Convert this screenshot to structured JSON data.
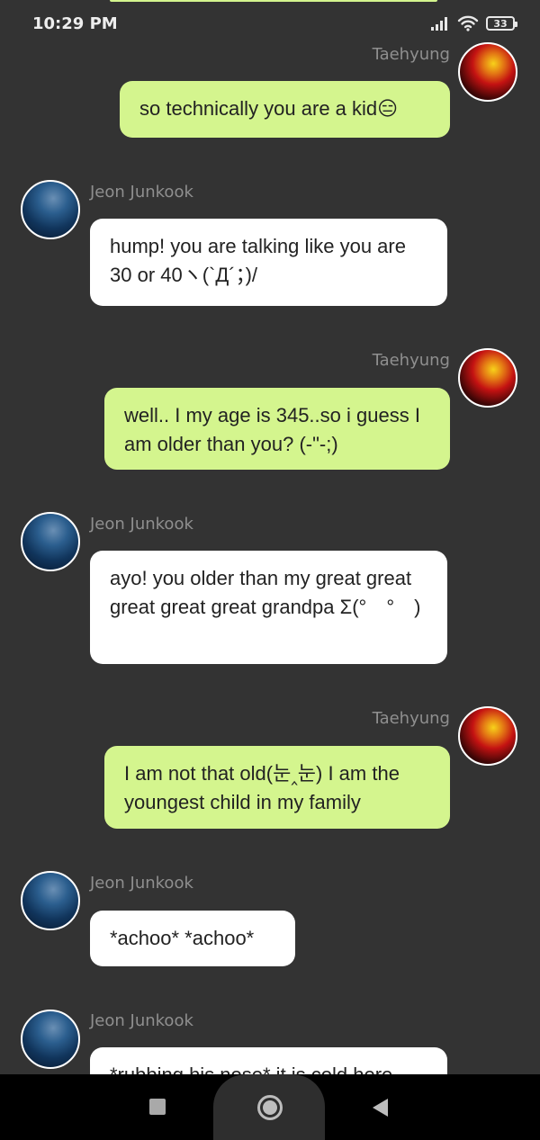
{
  "status_bar": {
    "time": "10:29 PM",
    "battery_level": "33",
    "icons": [
      "signal-icon",
      "wifi-icon",
      "battery-icon"
    ]
  },
  "colors": {
    "background": "#333333",
    "sent_bubble": "#d4f58e",
    "received_bubble": "#ffffff",
    "sender_name": "#8f8f8f"
  },
  "messages": [
    {
      "sender": "Taehyung",
      "side": "right",
      "text": "so technically you are a kid😑"
    },
    {
      "sender": "Jeon Junkook",
      "side": "left",
      "text": "hump! you are talking like you are 30 or 40ヽ(`Д´；)/"
    },
    {
      "sender": "Taehyung",
      "side": "right",
      "text": "well.. I my age is 345..so i guess I am older than you? (-\"-;)"
    },
    {
      "sender": "Jeon Junkook",
      "side": "left",
      "text": "ayo! you older than my great great great great great grandpa Σ(°　°　)"
    },
    {
      "sender": "Taehyung",
      "side": "right",
      "text": "I am not that old(눈‸눈) I am the youngest child in my family"
    },
    {
      "sender": "Jeon Junkook",
      "side": "left",
      "text": "*achoo* *achoo*"
    },
    {
      "sender": "Jeon Junkook",
      "side": "left",
      "text": "*rubbing his nose* it is cold here"
    }
  ],
  "nav_bar": {
    "buttons": [
      "recents-button",
      "home-button",
      "back-button"
    ]
  }
}
